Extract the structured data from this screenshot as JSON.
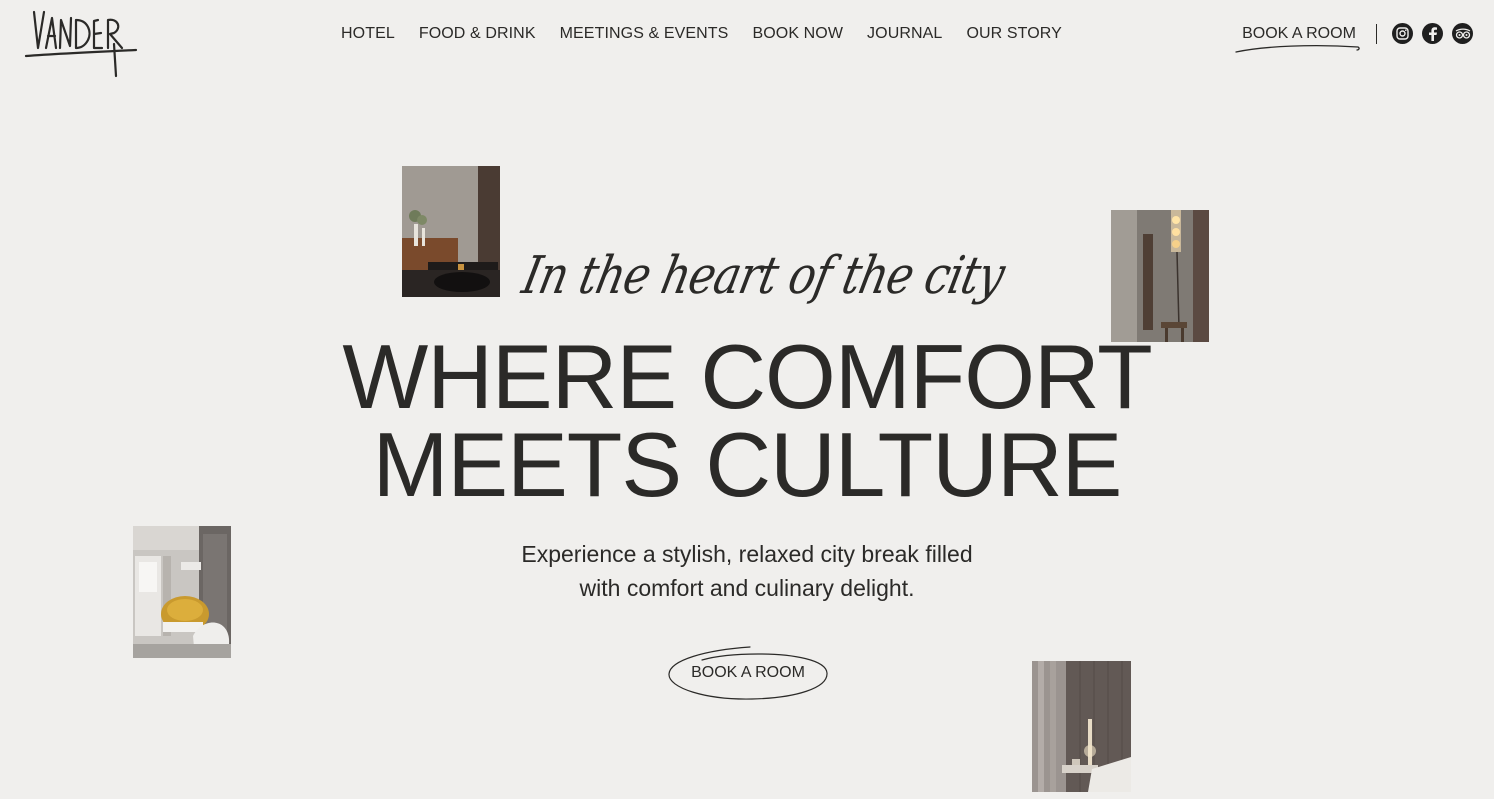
{
  "brand": {
    "logo_text": "VANDER"
  },
  "nav": {
    "items": [
      {
        "label": "HOTEL"
      },
      {
        "label": "FOOD & DRINK"
      },
      {
        "label": "MEETINGS & EVENTS"
      },
      {
        "label": "BOOK NOW"
      },
      {
        "label": "JOURNAL"
      },
      {
        "label": "OUR STORY"
      }
    ],
    "book_label": "BOOK A ROOM"
  },
  "social": [
    {
      "icon": "instagram-icon"
    },
    {
      "icon": "facebook-icon"
    },
    {
      "icon": "tripadvisor-icon"
    }
  ],
  "hero": {
    "script": "In the heart of the city",
    "headline_line1": "WHERE COMFORT",
    "headline_line2": "MEETS CULTURE",
    "sub_line1": "Experience a stylish, relaxed city break filled",
    "sub_line2": "with comfort and culinary delight.",
    "cta_label": "BOOK A ROOM"
  },
  "colors": {
    "background": "#f0efed",
    "text": "#2b2a28",
    "accent_yellow": "#c99a2e"
  }
}
